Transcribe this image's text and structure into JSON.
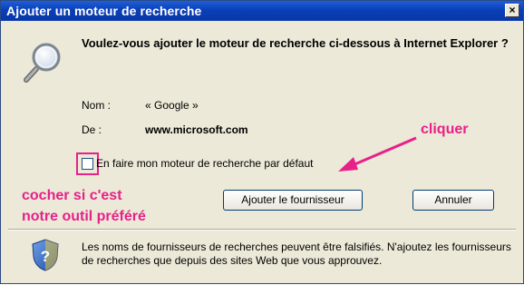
{
  "window": {
    "title": "Ajouter un moteur de recherche",
    "close_label": "×"
  },
  "dialog": {
    "question": "Voulez-vous ajouter le moteur de recherche ci-dessous à Internet Explorer ?",
    "name_label": "Nom :",
    "name_value": "« Google »",
    "from_label": "De :",
    "from_value": "www.microsoft.com",
    "default_checkbox_label": "En faire mon moteur de recherche par défaut",
    "default_checked": false,
    "add_button": "Ajouter le fournisseur",
    "cancel_button": "Annuler",
    "warning_text": "Les noms de fournisseurs de recherches peuvent être falsifiés. N'ajoutez les fournisseurs de recherches que depuis des sites Web que vous approuvez."
  },
  "annotations": {
    "click_label": "cliquer",
    "check_label_line1": "cocher si c'est",
    "check_label_line2": "notre outil préféré",
    "color": "#e8208a"
  },
  "icons": {
    "search": "magnifier-icon",
    "warning": "shield-question-icon",
    "close": "close-icon"
  }
}
